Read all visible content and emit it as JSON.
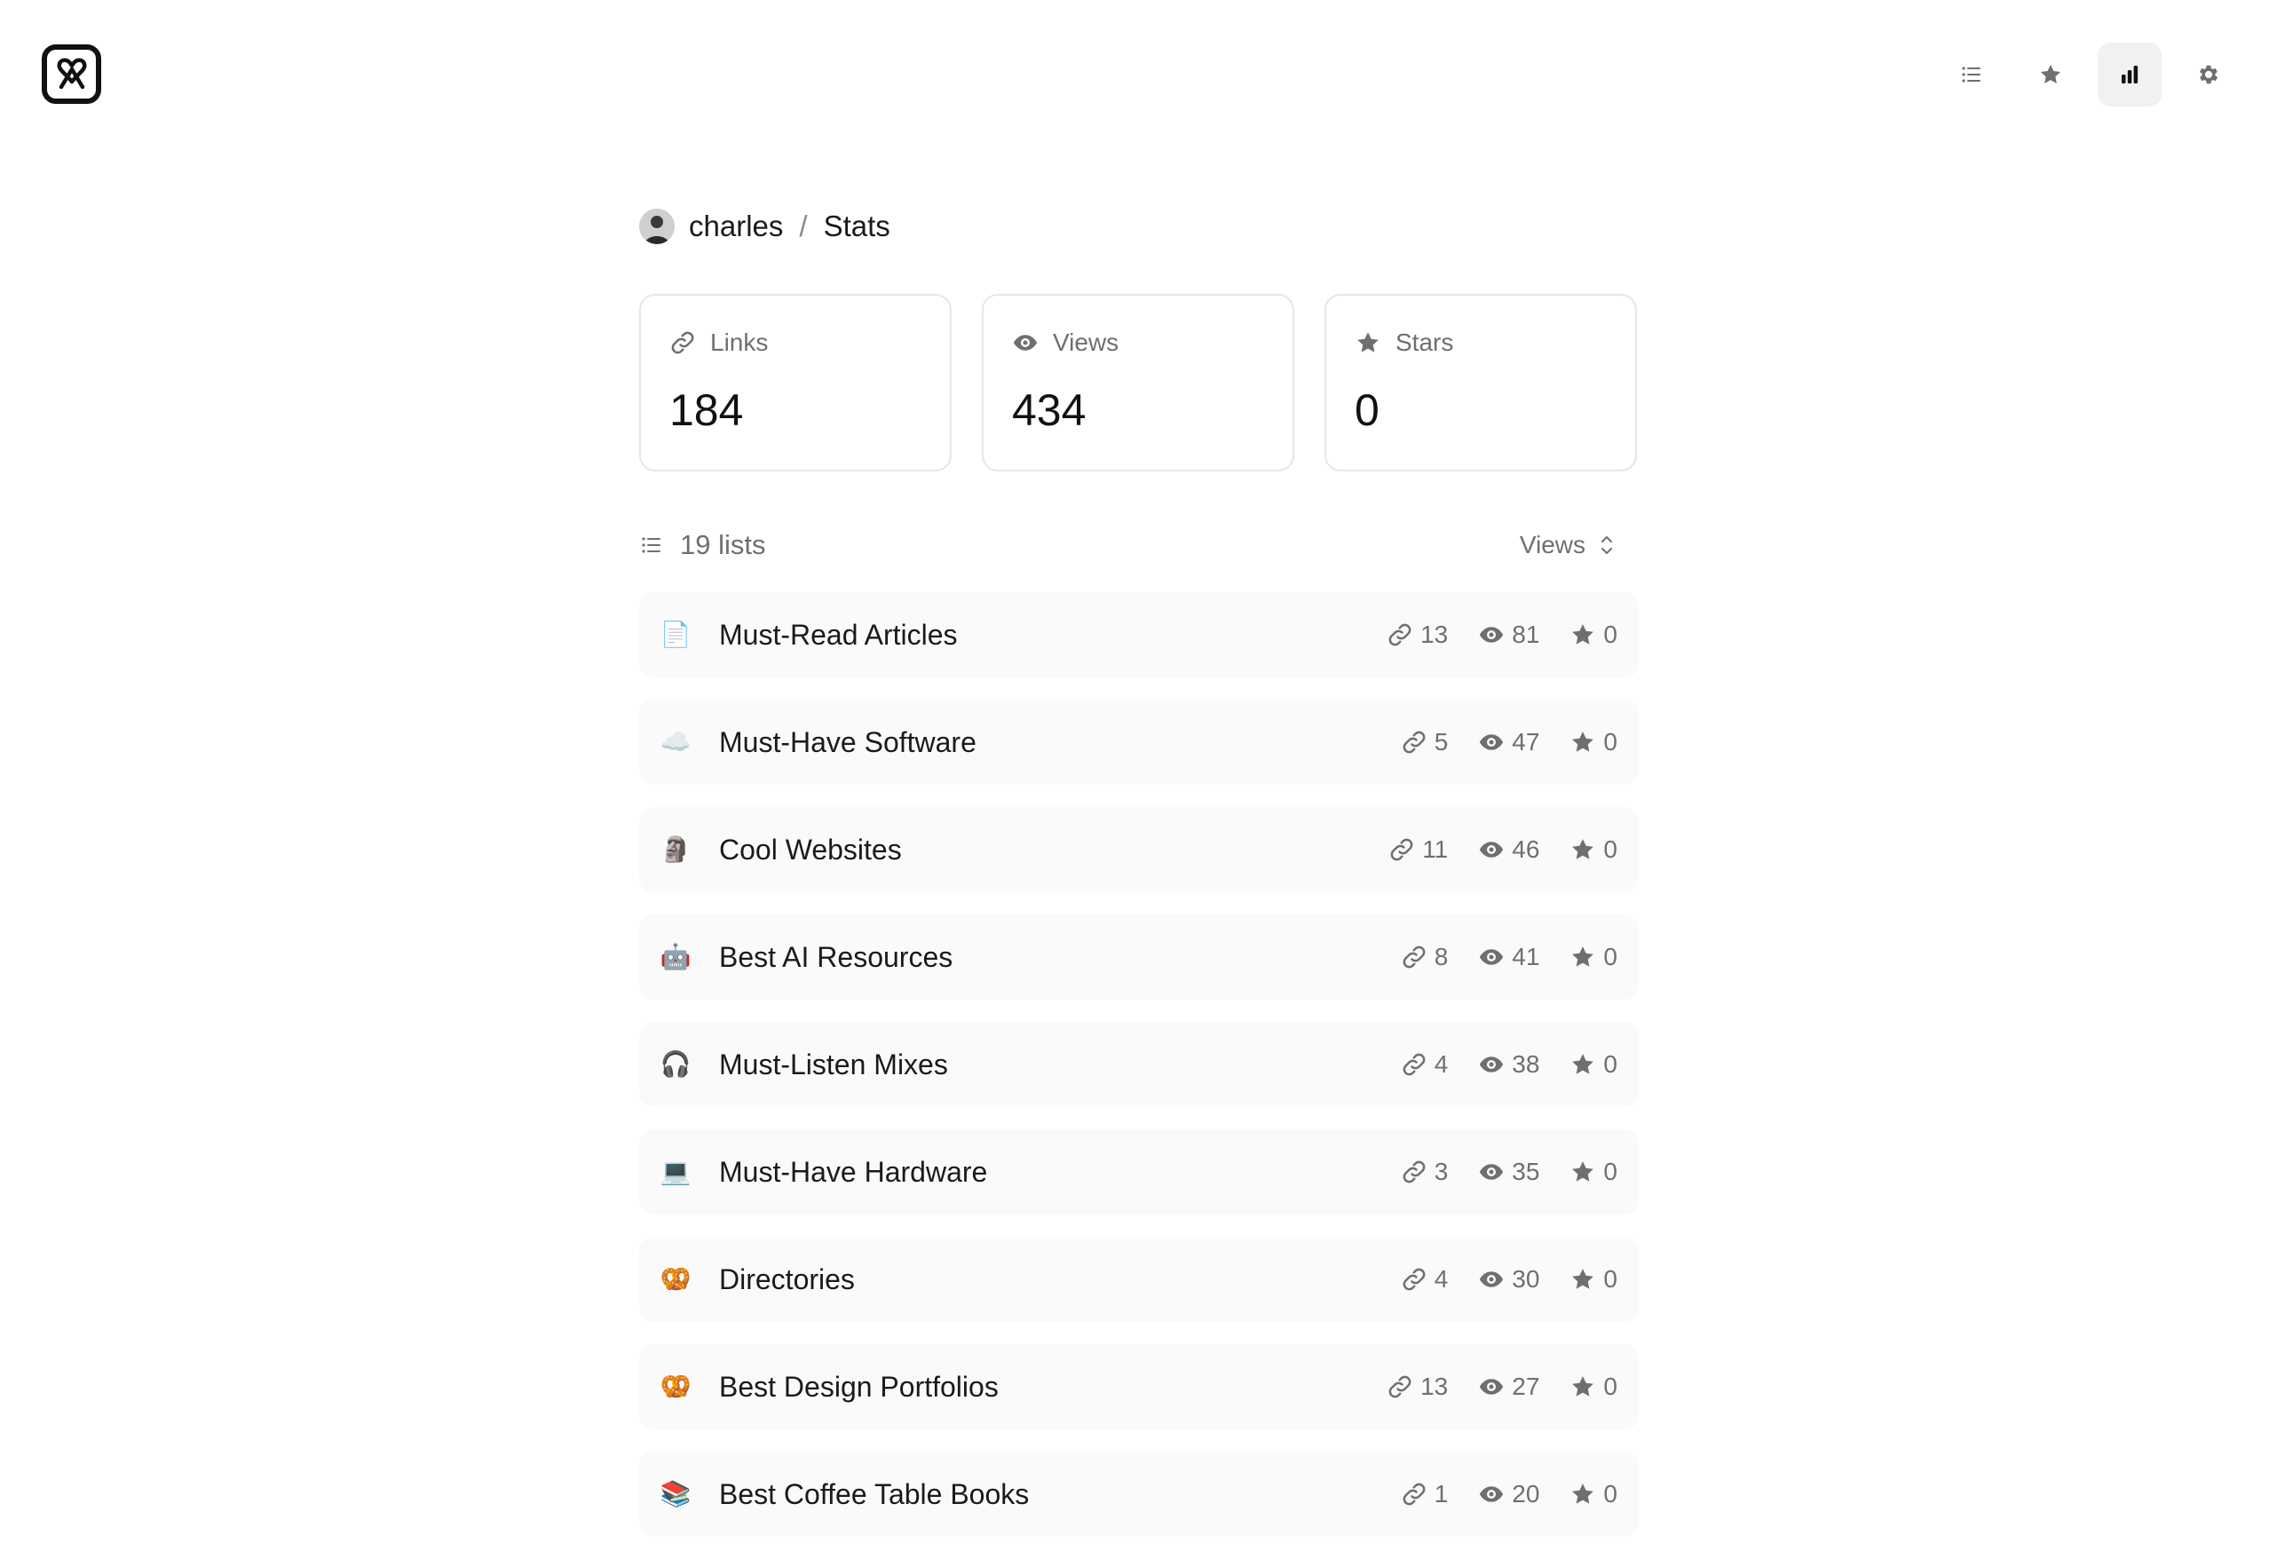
{
  "nav": {
    "items": [
      {
        "name": "lists",
        "icon": "list-icon"
      },
      {
        "name": "starred",
        "icon": "star-icon"
      },
      {
        "name": "stats",
        "icon": "bar-chart-icon",
        "active": true
      },
      {
        "name": "settings",
        "icon": "gear-icon"
      }
    ]
  },
  "breadcrumb": {
    "user": "charles",
    "separator": "/",
    "page": "Stats"
  },
  "summary": {
    "links": {
      "label": "Links",
      "value": "184",
      "icon": "link-icon"
    },
    "views": {
      "label": "Views",
      "value": "434",
      "icon": "eye-icon"
    },
    "stars": {
      "label": "Stars",
      "value": "0",
      "icon": "star-icon"
    }
  },
  "lists_header": {
    "count_label": "19 lists",
    "sort_label": "Views"
  },
  "lists": [
    {
      "icon": "📄",
      "name": "Must-Read Articles",
      "links": "13",
      "views": "81",
      "stars": "0"
    },
    {
      "icon": "☁️",
      "name": "Must-Have Software",
      "links": "5",
      "views": "47",
      "stars": "0"
    },
    {
      "icon": "🗿",
      "name": "Cool Websites",
      "links": "11",
      "views": "46",
      "stars": "0"
    },
    {
      "icon": "🤖",
      "name": "Best AI Resources",
      "links": "8",
      "views": "41",
      "stars": "0"
    },
    {
      "icon": "🎧",
      "name": "Must-Listen Mixes",
      "links": "4",
      "views": "38",
      "stars": "0"
    },
    {
      "icon": "💻",
      "name": "Must-Have Hardware",
      "links": "3",
      "views": "35",
      "stars": "0"
    },
    {
      "icon": "🥨",
      "name": "Directories",
      "links": "4",
      "views": "30",
      "stars": "0"
    },
    {
      "icon": "🥨",
      "name": "Best Design Portfolios",
      "links": "13",
      "views": "27",
      "stars": "0"
    },
    {
      "icon": "📚",
      "name": "Best Coffee Table Books",
      "links": "1",
      "views": "20",
      "stars": "0"
    }
  ]
}
